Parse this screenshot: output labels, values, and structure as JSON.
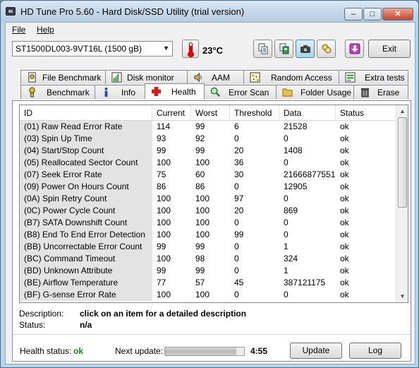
{
  "window": {
    "title": "HD Tune Pro 5.60 - Hard Disk/SSD Utility (trial version)",
    "controls": {
      "minimize": "–",
      "maximize": "□",
      "close": "✕"
    }
  },
  "menu": [
    {
      "label": "File"
    },
    {
      "label": "Help"
    }
  ],
  "toolbar": {
    "drive": "ST1500DL003-9VT16L (1500 gB)",
    "temperature": "23°C",
    "exit_label": "Exit",
    "buttons": [
      {
        "icon": "copy-text-icon"
      },
      {
        "icon": "copy-screenshot-icon"
      },
      {
        "icon": "camera-icon"
      },
      {
        "icon": "options-icon"
      },
      {
        "icon": "save-down-arrow-icon"
      }
    ]
  },
  "tabs": {
    "top": [
      {
        "label": "File Benchmark",
        "icon": "file-benchmark-icon"
      },
      {
        "label": "Disk monitor",
        "icon": "disk-monitor-icon"
      },
      {
        "label": "AAM",
        "icon": "speaker-icon"
      },
      {
        "label": "Random Access",
        "icon": "random-access-icon"
      },
      {
        "label": "Extra tests",
        "icon": "extra-tests-icon"
      }
    ],
    "bottom": [
      {
        "label": "Benchmark",
        "icon": "benchmark-icon"
      },
      {
        "label": "Info",
        "icon": "info-icon"
      },
      {
        "label": "Health",
        "icon": "health-cross-icon"
      },
      {
        "label": "Error Scan",
        "icon": "magnifier-icon"
      },
      {
        "label": "Folder Usage",
        "icon": "folder-icon"
      },
      {
        "label": "Erase",
        "icon": "trash-icon"
      }
    ],
    "active": "Health"
  },
  "health": {
    "columns": [
      "ID",
      "Current",
      "Worst",
      "Threshold",
      "Data",
      "Status"
    ],
    "rows": [
      [
        "(01) Raw Read Error Rate",
        "114",
        "99",
        "6",
        "21528",
        "ok"
      ],
      [
        "(03) Spin Up Time",
        "93",
        "92",
        "0",
        "0",
        "ok"
      ],
      [
        "(04) Start/Stop Count",
        "99",
        "99",
        "20",
        "1408",
        "ok"
      ],
      [
        "(05) Reallocated Sector Count",
        "100",
        "100",
        "36",
        "0",
        "ok"
      ],
      [
        "(07) Seek Error Rate",
        "75",
        "60",
        "30",
        "21666877551",
        "ok"
      ],
      [
        "(09) Power On Hours Count",
        "86",
        "86",
        "0",
        "12905",
        "ok"
      ],
      [
        "(0A) Spin Retry Count",
        "100",
        "100",
        "97",
        "0",
        "ok"
      ],
      [
        "(0C) Power Cycle Count",
        "100",
        "100",
        "20",
        "869",
        "ok"
      ],
      [
        "(B7) SATA Downshift Count",
        "100",
        "100",
        "0",
        "0",
        "ok"
      ],
      [
        "(B8) End To End Error Detection",
        "100",
        "100",
        "99",
        "0",
        "ok"
      ],
      [
        "(BB) Uncorrectable Error Count",
        "99",
        "99",
        "0",
        "1",
        "ok"
      ],
      [
        "(BC) Command Timeout",
        "100",
        "98",
        "0",
        "324",
        "ok"
      ],
      [
        "(BD) Unknown Attribute",
        "99",
        "99",
        "0",
        "1",
        "ok"
      ],
      [
        "(BE) Airflow Temperature",
        "77",
        "57",
        "45",
        "387121175",
        "ok"
      ],
      [
        "(BF) G-sense Error Rate",
        "100",
        "100",
        "0",
        "0",
        "ok"
      ]
    ],
    "description_label": "Description:",
    "description_value": "click on an item for a detailed description",
    "status_label": "Status:",
    "status_value": "n/a",
    "health_status_label": "Health status:",
    "health_status_value": "ok",
    "health_status_color": "#1a8a1a",
    "next_update_label": "Next update:",
    "next_update_progress": 0.9,
    "next_update_time": "4:55",
    "update_button": "Update",
    "log_button": "Log"
  }
}
